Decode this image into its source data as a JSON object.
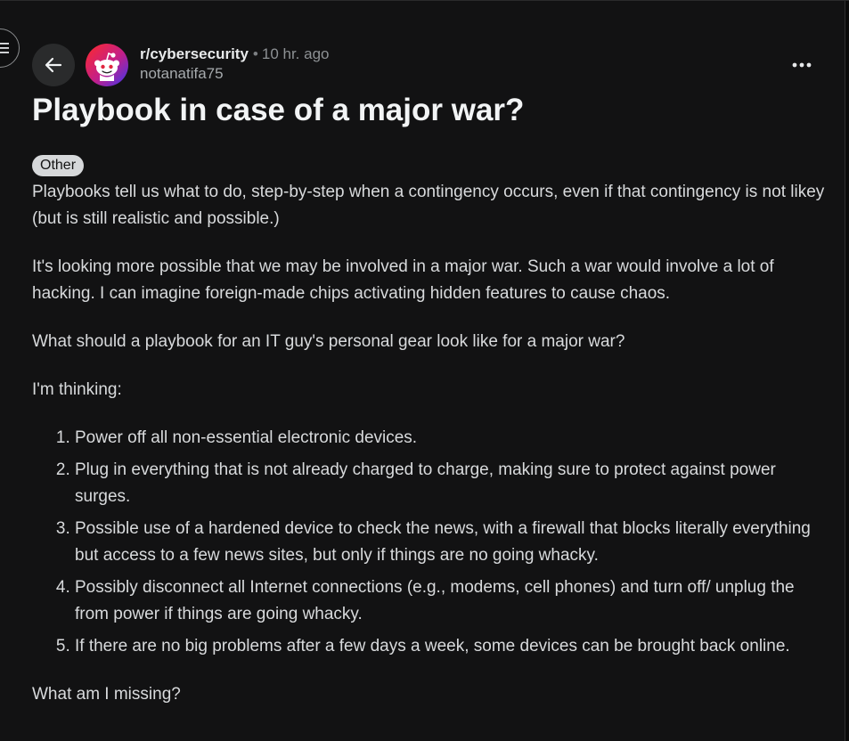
{
  "post": {
    "subreddit": "r/cybersecurity",
    "separator": "•",
    "time": "10 hr. ago",
    "author": "notanatifa75",
    "title": "Playbook in case of a major war?",
    "flair": "Other",
    "paragraphs": [
      "Playbooks tell us what to do, step-by-step when a contingency occurs, even if that contingency is not likey (but is still realistic and possible.)",
      "It's looking more possible that we may be involved in a major war. Such a war would involve a lot of hacking. I can imagine foreign-made chips activating hidden features to cause chaos.",
      "What should a playbook for an IT guy's personal gear look like for a major war?",
      "I'm thinking:"
    ],
    "list_items": [
      "Power off all non-essential electronic devices.",
      "Plug in everything that is not already charged to charge, making sure to protect against power surges.",
      "Possible use of a hardened device to check the news, with a firewall that blocks literally everything but access to a few news sites, but only if things are no going whacky.",
      "Possibly disconnect all Internet connections (e.g., modems, cell phones) and turn off/ unplug the from power if things are going whacky.",
      "If there are no big problems after a few days a week, some devices can be brought back online."
    ],
    "closing": "What am I missing?"
  },
  "icons": {
    "menu": "hamburger-icon",
    "back": "arrow-left-icon",
    "avatar": "reddit-snoo-icon",
    "more": "more-horizontal-icon"
  },
  "colors": {
    "background": "#121213",
    "avatar_gradient": [
      "#ff2a2a",
      "#c21f8a",
      "#3b36f0"
    ],
    "flair_bg": "#d6d8da"
  }
}
